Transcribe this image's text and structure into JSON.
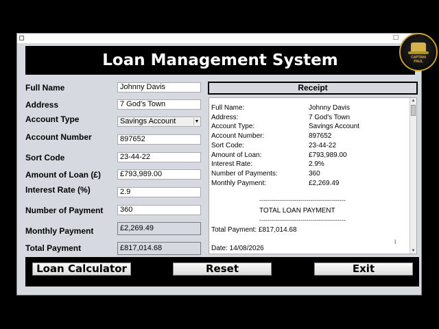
{
  "header": {
    "title": "Loan Management System"
  },
  "form": {
    "full_name_label": "Full Name",
    "full_name_value": "Johnny Davis",
    "address_label": "Address",
    "address_value": "7 God's Town",
    "account_type_label": "Account Type",
    "account_type_value": "Savings  Account",
    "account_number_label": "Account Number",
    "account_number_value": "897652",
    "sort_code_label": "Sort Code",
    "sort_code_value": "23-44-22",
    "amount_label": "Amount of Loan (£)",
    "amount_value": "£793,989.00",
    "interest_label": "Interest Rate (%)",
    "interest_value": "2.9",
    "num_payment_label": "Number of Payment",
    "num_payment_value": "360",
    "monthly_label": "Monthly Payment",
    "monthly_value": "£2,269.49",
    "total_label": "Total Payment",
    "total_value": "£817,014.68"
  },
  "receipt": {
    "title": "Receipt",
    "rows": [
      {
        "key": "Full Name:",
        "value": "Johnny Davis"
      },
      {
        "key": "Address:",
        "value": "7 God's Town"
      },
      {
        "key": "Account Type:",
        "value": "Savings  Account"
      },
      {
        "key": "Account Number:",
        "value": "897652"
      },
      {
        "key": "Sort Code:",
        "value": "23-44-22"
      },
      {
        "key": "Amount of Loan:",
        "value": "£793,989.00"
      },
      {
        "key": "Interest Rate:",
        "value": "2.9%"
      },
      {
        "key": "Number of Payments:",
        "value": "360"
      },
      {
        "key": "Monthly Payment:",
        "value": "£2,269.49"
      }
    ],
    "divider": "------------------------------------------",
    "total_heading": "TOTAL LOAN PAYMENT",
    "total_line": "Total Payment: £817,014.68",
    "date_line": "Date: 14/08/2026"
  },
  "buttons": {
    "calculator": "Loan Calculator",
    "reset": "Reset",
    "exit": "Exit"
  },
  "window": {
    "maximize_glyph": "□",
    "close_glyph": "✕"
  },
  "logo": {
    "text_line1": "CAPTAIN",
    "text_line2": "PAUL"
  },
  "icons": {
    "app": "app-icon",
    "dropdown": "chevron-down-icon",
    "logo": "captain-logo"
  }
}
